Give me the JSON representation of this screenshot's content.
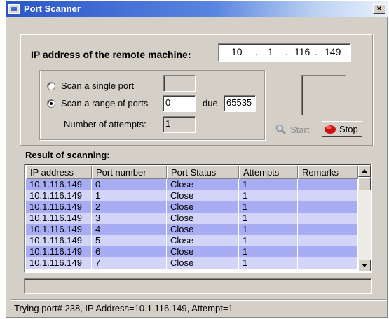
{
  "window": {
    "title": "Port Scanner",
    "close_glyph": "×"
  },
  "ip": {
    "label": "IP address of the remote machine:",
    "octets": [
      "10",
      "1",
      "116",
      "149"
    ],
    "separator": "."
  },
  "scan": {
    "single_label": "Scan a single port",
    "range_label": "Scan a range of ports",
    "selected": "range",
    "single_port_value": "",
    "range_from": "0",
    "due_label": "due",
    "range_to": "65535",
    "attempts_label": "Number of attempts:",
    "attempts_value": "1"
  },
  "buttons": {
    "start_label": "Start",
    "stop_label": "Stop"
  },
  "results": {
    "label": "Result of scanning:",
    "columns": [
      "IP address",
      "Port number",
      "Port Status",
      "Attempts",
      "Remarks"
    ],
    "rows": [
      [
        "10.1.116.149",
        "0",
        "Close",
        "1",
        ""
      ],
      [
        "10.1.116.149",
        "1",
        "Close",
        "1",
        ""
      ],
      [
        "10.1.116.149",
        "2",
        "Close",
        "1",
        ""
      ],
      [
        "10.1.116.149",
        "3",
        "Close",
        "1",
        ""
      ],
      [
        "10.1.116.149",
        "4",
        "Close",
        "1",
        ""
      ],
      [
        "10.1.116.149",
        "5",
        "Close",
        "1",
        ""
      ],
      [
        "10.1.116.149",
        "6",
        "Close",
        "1",
        ""
      ],
      [
        "10.1.116.149",
        "7",
        "Close",
        "1",
        ""
      ]
    ]
  },
  "status": {
    "text": "Trying port# 238, IP Address=10.1.116.149, Attempt=1"
  },
  "icons": {
    "start": "magnifier-icon",
    "stop": "red-stop-icon",
    "scroll_up": "scroll-up-arrow-icon",
    "scroll_down": "scroll-down-arrow-icon",
    "app": "port-scanner-app-icon"
  }
}
